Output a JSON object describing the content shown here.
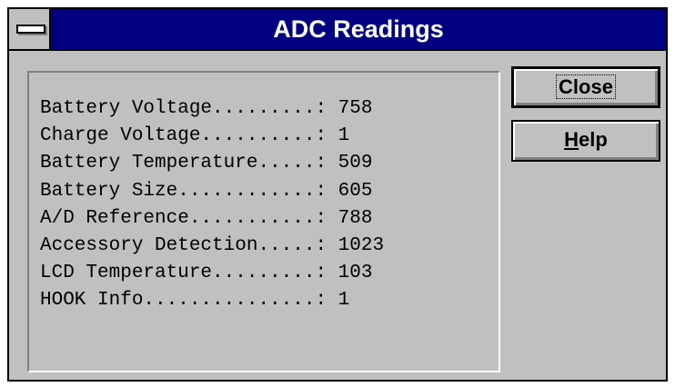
{
  "window": {
    "title": "ADC Readings"
  },
  "readings": [
    {
      "label": "Battery Voltage.........:",
      "value": "758"
    },
    {
      "label": "Charge Voltage..........:",
      "value": "1"
    },
    {
      "label": "Battery Temperature.....:",
      "value": "509"
    },
    {
      "label": "Battery Size............:",
      "value": "605"
    },
    {
      "label": "A/D Reference...........:",
      "value": "788"
    },
    {
      "label": "Accessory Detection.....:",
      "value": "1023"
    },
    {
      "label": "LCD Temperature.........:",
      "value": "103"
    },
    {
      "label": "HOOK Info...............:",
      "value": "1"
    }
  ],
  "buttons": {
    "close_label": "Close",
    "help_mnemonic": "H",
    "help_rest": "elp"
  },
  "colors": {
    "titlebar": "#000080",
    "face": "#c0c0c0"
  }
}
